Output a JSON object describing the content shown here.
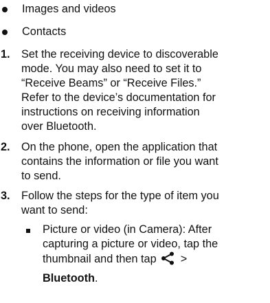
{
  "bullets": [
    "Images and videos",
    "Contacts"
  ],
  "steps": [
    {
      "number": "1.",
      "lines": [
        "Set the receiving device to discoverable",
        "mode. You may also need to set it to",
        "“Receive Beams” or “Receive Files.”",
        "Refer to the device’s documentation for",
        "instructions on receiving information",
        "over Bluetooth."
      ]
    },
    {
      "number": "2.",
      "lines": [
        "On the phone, open the application that",
        "contains the information or file you want",
        "to send."
      ]
    },
    {
      "number": "3.",
      "lines": [
        "Follow the steps for the type of item you",
        "want to send:"
      ]
    }
  ],
  "sub_bullet": {
    "line1": "Picture or video (in Camera): After",
    "line2": "capturing a picture or video, tap the",
    "line3_before": "thumbnail and then tap",
    "line3_after": ">",
    "line4_bold": "Bluetooth",
    "line4_end": ".",
    "icon": "share-icon"
  }
}
